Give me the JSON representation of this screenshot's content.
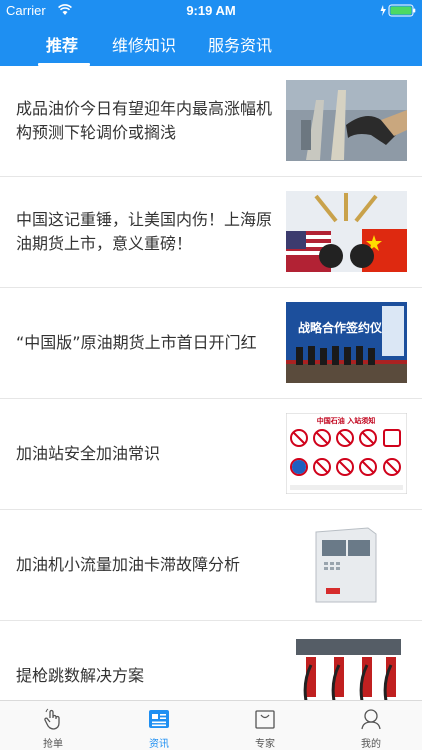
{
  "status_bar": {
    "carrier": "Carrier",
    "time": "9:19 AM"
  },
  "tabs": [
    {
      "label": "推荐",
      "active": true
    },
    {
      "label": "维修知识",
      "active": false
    },
    {
      "label": "服务资讯",
      "active": false
    }
  ],
  "articles": [
    {
      "title": "成品油价今日有望迎年内最高涨幅机构预测下轮调价或搁浅",
      "thumb_icon": "fuel-nozzle-photo"
    },
    {
      "title": "中国这记重锤，让美国内伤！上海原油期货上市，意义重磅！",
      "thumb_icon": "us-china-flags-photo"
    },
    {
      "title": "“中国版”原油期货上市首日开门红",
      "thumb_icon": "signing-ceremony-photo",
      "thumb_text": "战略合作签约仪式"
    },
    {
      "title": "加油站安全加油常识",
      "thumb_icon": "safety-notice-sign",
      "thumb_text": "中国石油 入站须知"
    },
    {
      "title": "加油机小流量加油卡滞故障分析",
      "thumb_icon": "fuel-dispenser-photo"
    },
    {
      "title": "提枪跳数解决方案",
      "thumb_icon": "pump-nozzles-photo"
    }
  ],
  "bottom_tabs": [
    {
      "label": "抢单",
      "icon": "hand-tap-icon",
      "active": false
    },
    {
      "label": "资讯",
      "icon": "news-icon",
      "active": true
    },
    {
      "label": "专家",
      "icon": "bag-icon",
      "active": false
    },
    {
      "label": "我的",
      "icon": "user-icon",
      "active": false
    }
  ],
  "colors": {
    "primary": "#1e8ff2",
    "text": "#333333",
    "divider": "#e6e6e6"
  }
}
